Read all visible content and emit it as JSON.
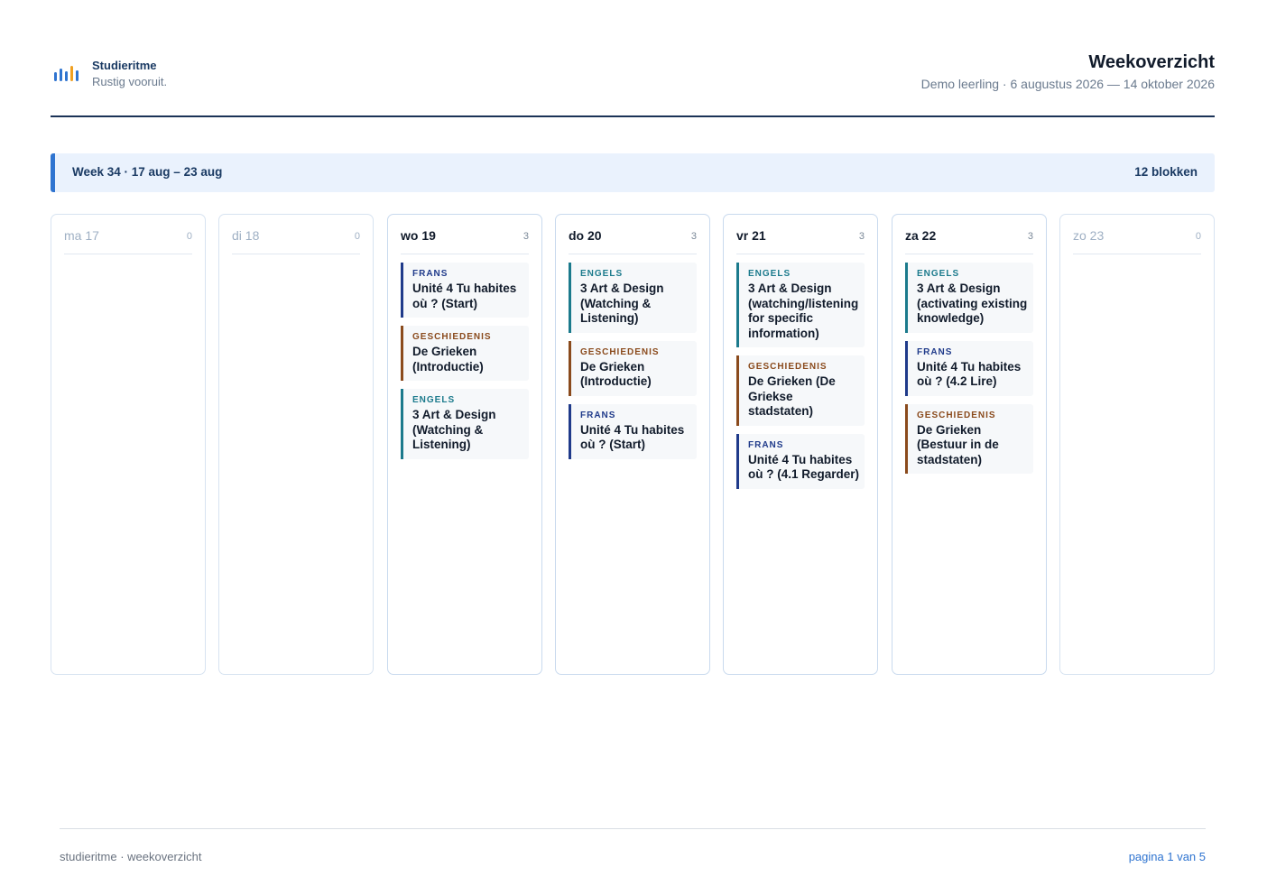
{
  "brand": {
    "name": "Studieritme",
    "tagline": "Rustig vooruit."
  },
  "document": {
    "title": "Weekoverzicht",
    "subtitle": "Demo leerling · 6 augustus 2026 — 14 oktober 2026"
  },
  "week": {
    "label": "Week 34 · 17 aug – 23 aug",
    "count": "12 blokken"
  },
  "days": [
    {
      "name": "ma 17",
      "count": "0",
      "blocks": []
    },
    {
      "name": "di 18",
      "count": "0",
      "blocks": []
    },
    {
      "name": "wo 19",
      "count": "3",
      "blocks": [
        {
          "subject": "FRANS",
          "kind": "frans",
          "title": "Unité 4 Tu habites où ? (Start)"
        },
        {
          "subject": "GESCHIEDENIS",
          "kind": "geschiedenis",
          "title": "De Grieken (Introductie)"
        },
        {
          "subject": "ENGELS",
          "kind": "engels",
          "title": "3 Art & Design (Watching & Listening)"
        }
      ]
    },
    {
      "name": "do 20",
      "count": "3",
      "blocks": [
        {
          "subject": "ENGELS",
          "kind": "engels",
          "title": "3 Art & Design (Watching & Listening)"
        },
        {
          "subject": "GESCHIEDENIS",
          "kind": "geschiedenis",
          "title": "De Grieken (Introductie)"
        },
        {
          "subject": "FRANS",
          "kind": "frans",
          "title": "Unité 4 Tu habites où ? (Start)"
        }
      ]
    },
    {
      "name": "vr 21",
      "count": "3",
      "blocks": [
        {
          "subject": "ENGELS",
          "kind": "engels",
          "title": "3 Art & Design (watching/listening for specific information)"
        },
        {
          "subject": "GESCHIEDENIS",
          "kind": "geschiedenis",
          "title": "De Grieken (De Griekse stadstaten)"
        },
        {
          "subject": "FRANS",
          "kind": "frans",
          "title": "Unité 4 Tu habites où ? (4.1 Regarder)"
        }
      ]
    },
    {
      "name": "za 22",
      "count": "3",
      "blocks": [
        {
          "subject": "ENGELS",
          "kind": "engels",
          "title": "3 Art & Design (activating existing knowledge)"
        },
        {
          "subject": "FRANS",
          "kind": "frans",
          "title": "Unité 4 Tu habites où ? (4.2 Lire)"
        },
        {
          "subject": "GESCHIEDENIS",
          "kind": "geschiedenis",
          "title": "De Grieken (Bestuur in de stadstaten)"
        }
      ]
    },
    {
      "name": "zo 23",
      "count": "0",
      "blocks": []
    }
  ],
  "footer": {
    "left": "studieritme · weekoverzicht",
    "right": "pagina 1 van 5"
  },
  "colors": {
    "accent": "#2f74d0",
    "engels": "#1b7a8c",
    "geschiedenis": "#8a4a1c",
    "frans": "#1f3a8a"
  }
}
